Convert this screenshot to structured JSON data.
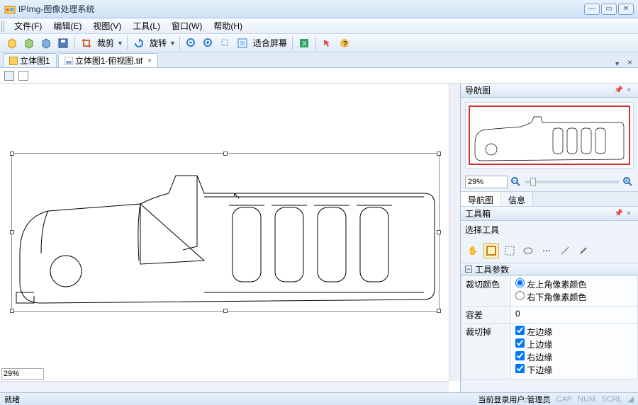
{
  "title": "IPImg-图像处理系统",
  "menus": [
    "文件(F)",
    "编辑(E)",
    "视图(V)",
    "工具(L)",
    "窗口(W)",
    "帮助(H)"
  ],
  "toolbar": {
    "crop": "裁剪",
    "rotate": "旋转",
    "fit": "适合屏幕"
  },
  "tabs": [
    {
      "label": "立体图1",
      "active": false
    },
    {
      "label": "立体图1-俯视图.tif",
      "active": true
    }
  ],
  "canvas": {
    "zoom": "29%"
  },
  "right": {
    "nav_title": "导航图",
    "nav_zoom": "29%",
    "minitabs": [
      "导航图",
      "信息"
    ],
    "toolbox_title": "工具箱",
    "toolbox_sub": "选择工具",
    "params_title": "工具参数",
    "params": {
      "crop_color_label": "裁切颜色",
      "crop_color_opt1": "左上角像素颜色",
      "crop_color_opt2": "右下角像素颜色",
      "tolerance_label": "容差",
      "tolerance_value": "0",
      "crop_edges_label": "裁切掉",
      "edges": [
        "左边缘",
        "上边缘",
        "右边缘",
        "下边缘"
      ]
    }
  },
  "status": {
    "ready": "就绪",
    "user": "当前登录用户:管理员",
    "caps": "CAP",
    "num": "NUM",
    "scrl": "SCRL"
  }
}
